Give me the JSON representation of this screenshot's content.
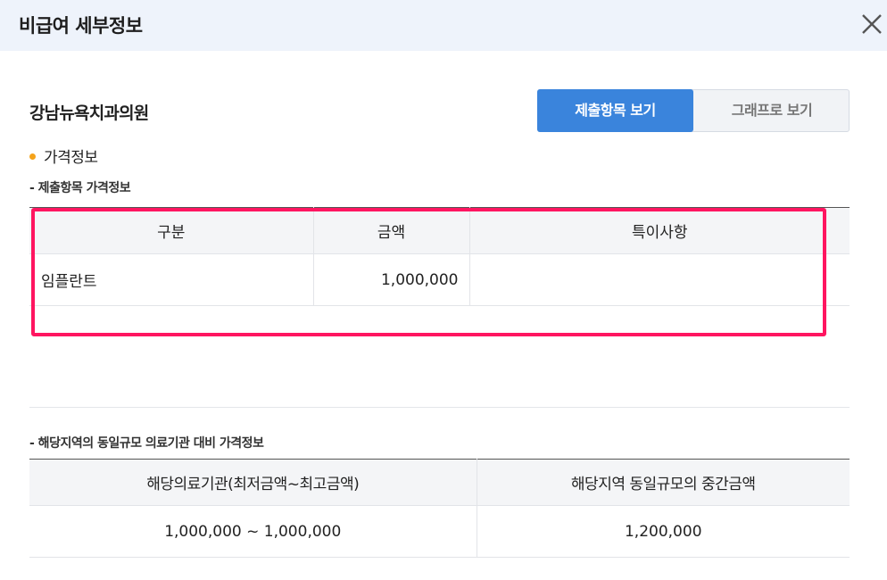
{
  "modal": {
    "title": "비급여 세부정보"
  },
  "hospital": {
    "name": "강남뉴욕치과의원"
  },
  "view_toggle": {
    "submitted_label": "제출항목 보기",
    "graph_label": "그래프로 보기"
  },
  "section": {
    "label": "가격정보"
  },
  "submitted_price": {
    "subheading": "- 제출항목 가격정보",
    "headers": [
      "구분",
      "금액",
      "특이사항"
    ],
    "rows": [
      [
        "임플란트",
        "1,000,000",
        ""
      ]
    ]
  },
  "regional_price": {
    "subheading": "- 해당지역의 동일규모 의료기관 대비 가격정보",
    "headers": [
      "해당의료기관(최저금액~최고금액)",
      "해당지역 동일규모의 중간금액"
    ],
    "rows": [
      [
        "1,000,000 ~ 1,000,000",
        "1,200,000"
      ]
    ]
  },
  "colors": {
    "accent": "#3a84dc",
    "highlight": "#ff1560",
    "bullet": "#f5a31a",
    "header_bg": "#eef3fb"
  },
  "icons": {
    "close": "close-icon"
  }
}
